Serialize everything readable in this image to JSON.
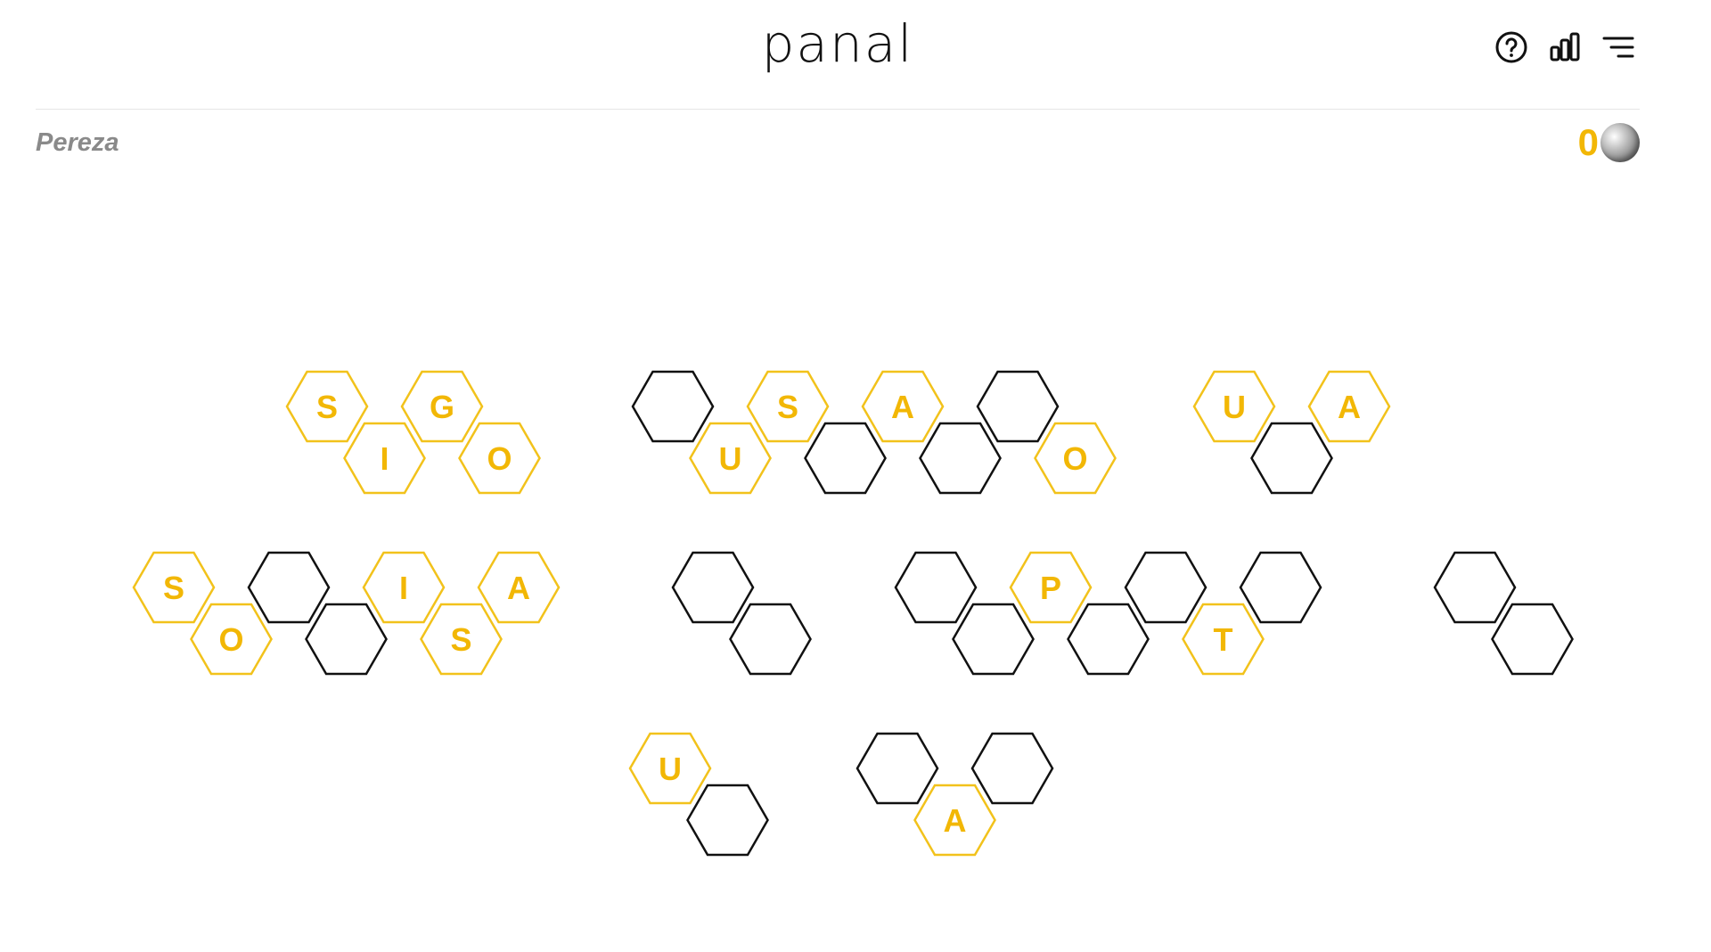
{
  "app": {
    "logo": "panal"
  },
  "header": {
    "icons": [
      "help-icon",
      "stats-icon",
      "menu-icon"
    ]
  },
  "category": "Pereza",
  "score": "0",
  "colors": {
    "accent": "#f2c21b",
    "letter": "#f2b705",
    "empty": "#111111",
    "category": "#8a8a8a"
  },
  "board": {
    "rows": [
      {
        "words": [
          {
            "cells": [
              [
                "S",
                "G"
              ],
              [
                "I",
                "O"
              ]
            ]
          },
          {
            "cells": [
              [
                "",
                "S",
                "A",
                ""
              ],
              [
                "U",
                "",
                "",
                "O"
              ]
            ]
          },
          {
            "cells": [
              [
                "U",
                "A"
              ],
              [
                ""
              ]
            ]
          }
        ]
      },
      {
        "words": [
          {
            "cells": [
              [
                "S",
                "",
                "I",
                "A"
              ],
              [
                "O",
                "",
                "S"
              ]
            ]
          },
          {
            "cells": [
              [
                ""
              ],
              [
                ""
              ]
            ]
          },
          {
            "cells": [
              [
                "",
                "P",
                "",
                ""
              ],
              [
                "",
                "",
                "T"
              ]
            ]
          },
          {
            "cells": [
              [
                ""
              ],
              [
                ""
              ]
            ]
          }
        ]
      },
      {
        "words": [
          {
            "cells": [
              [
                "U"
              ],
              [
                ""
              ]
            ]
          },
          {
            "cells": [
              [
                "",
                ""
              ],
              [
                "A"
              ]
            ]
          }
        ]
      }
    ]
  }
}
